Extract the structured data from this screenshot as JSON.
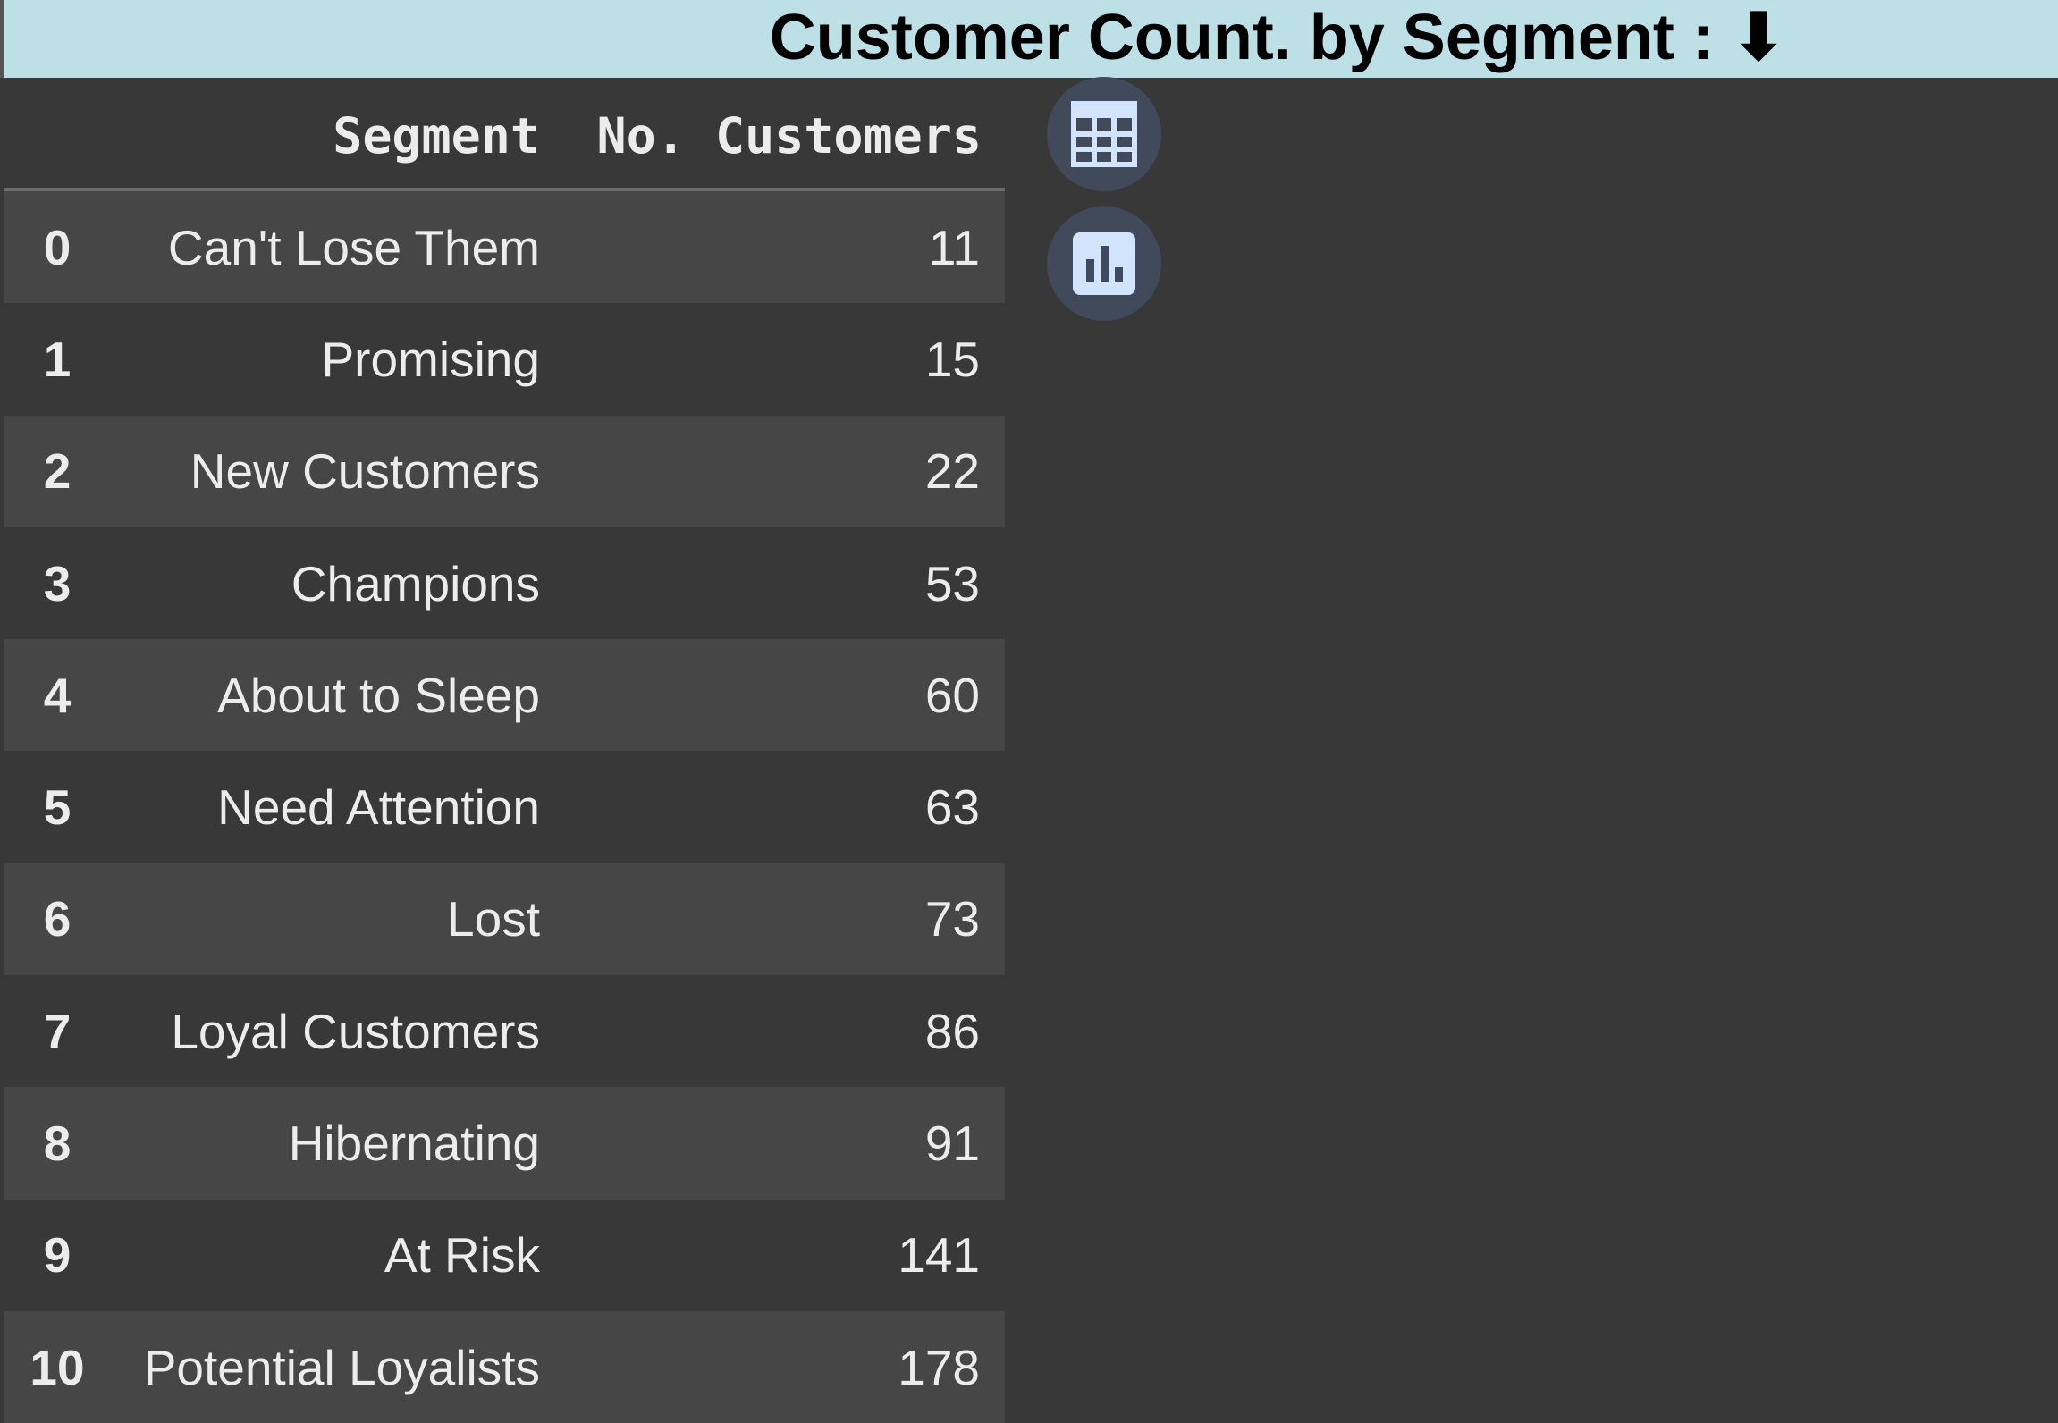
{
  "header": {
    "title": "Customer Count. by Segment : ⬇"
  },
  "table": {
    "columns": {
      "segment": "Segment",
      "count": "No. Customers"
    },
    "rows": [
      {
        "index": "0",
        "segment": "Can't Lose Them",
        "count": "11"
      },
      {
        "index": "1",
        "segment": "Promising",
        "count": "15"
      },
      {
        "index": "2",
        "segment": "New Customers",
        "count": "22"
      },
      {
        "index": "3",
        "segment": "Champions",
        "count": "53"
      },
      {
        "index": "4",
        "segment": "About to Sleep",
        "count": "60"
      },
      {
        "index": "5",
        "segment": "Need Attention",
        "count": "63"
      },
      {
        "index": "6",
        "segment": "Lost",
        "count": "73"
      },
      {
        "index": "7",
        "segment": "Loyal Customers",
        "count": "86"
      },
      {
        "index": "8",
        "segment": "Hibernating",
        "count": "91"
      },
      {
        "index": "9",
        "segment": "At Risk",
        "count": "141"
      },
      {
        "index": "10",
        "segment": "Potential Loyalists",
        "count": "178"
      }
    ]
  },
  "toolbar": {
    "table_icon": "table-icon",
    "chart_icon": "bar-chart-icon"
  },
  "colors": {
    "title_bg": "#bde0e6",
    "page_bg": "#383838",
    "row_alt_bg": "#464646",
    "icon_button_bg": "#414a5a",
    "icon_fg": "#d2e3fc"
  }
}
